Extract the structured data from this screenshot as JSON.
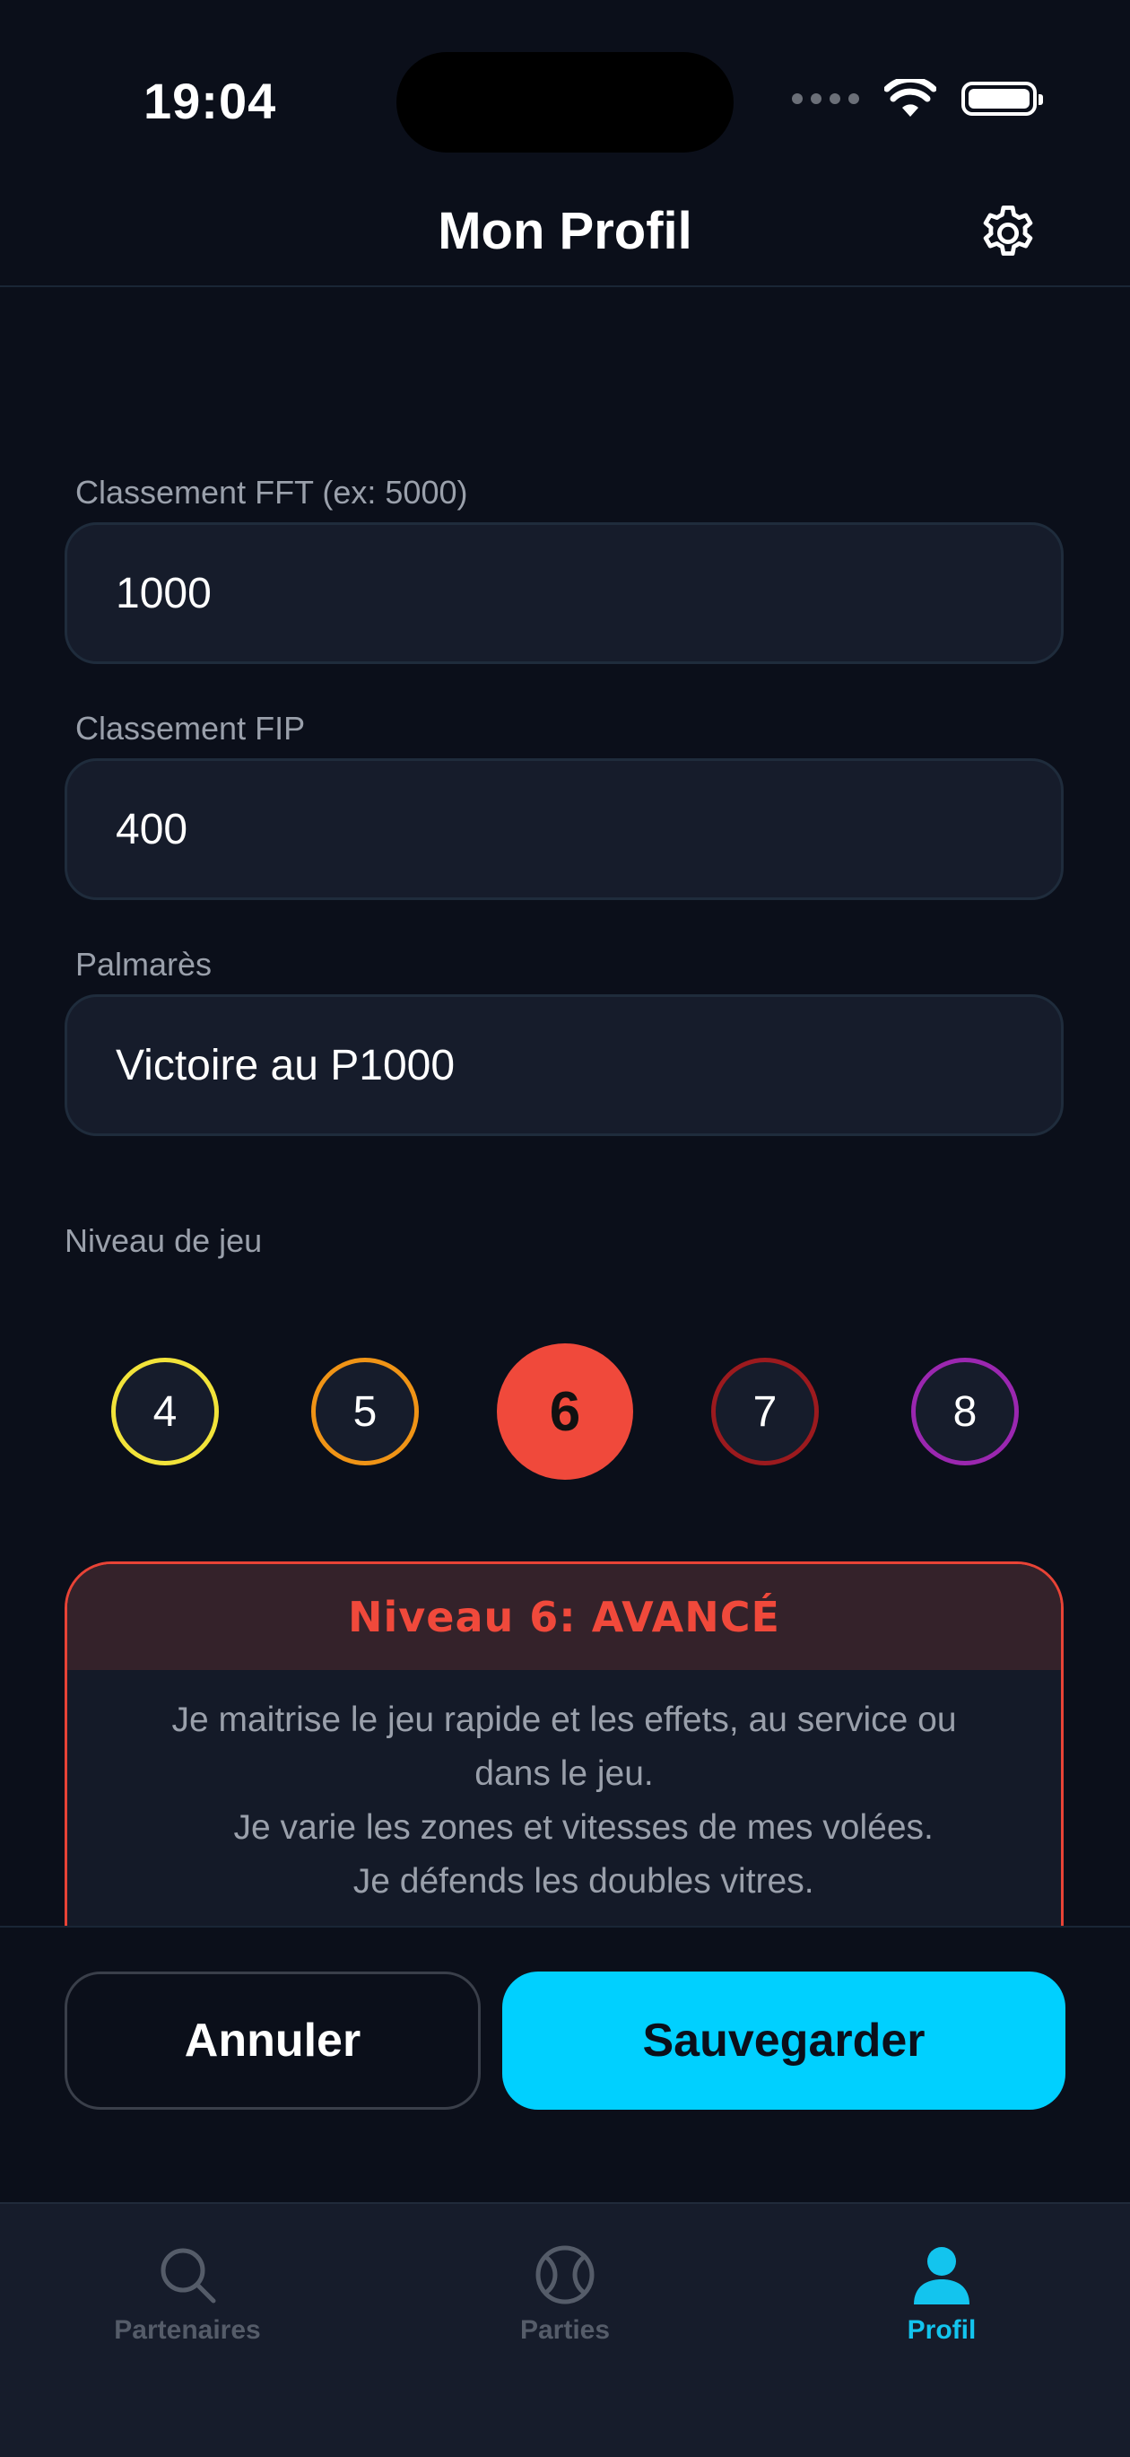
{
  "status_bar": {
    "time": "19:04"
  },
  "header": {
    "title": "Mon Profil"
  },
  "form": {
    "fft": {
      "label": "Classement FFT (ex: 5000)",
      "value": "1000"
    },
    "fip": {
      "label": "Classement FIP",
      "value": "400"
    },
    "palmares": {
      "label": "Palmarès",
      "value": "Victoire au P1000"
    }
  },
  "level": {
    "label": "Niveau de jeu",
    "options": [
      {
        "value": "4",
        "color": "#f2e33a"
      },
      {
        "value": "5",
        "color": "#f09416"
      },
      {
        "value": "6",
        "color": "#f0493b",
        "selected": true
      },
      {
        "value": "7",
        "color": "#9c1a1e"
      },
      {
        "value": "8",
        "color": "#9b27b0"
      }
    ],
    "card": {
      "title": "Niveau 6: AVANCÉ",
      "lines": [
        "Je maitrise le jeu rapide et les effets, au service ou",
        "dans le jeu.",
        "    Je varie les zones et vitesses de mes volées.",
        "    Je défends les doubles vitres."
      ]
    }
  },
  "actions": {
    "cancel": "Annuler",
    "save": "Sauvegarder"
  },
  "tabs": [
    {
      "label": "Partenaires",
      "icon": "search-icon"
    },
    {
      "label": "Parties",
      "icon": "tennis-ball-icon"
    },
    {
      "label": "Profil",
      "icon": "person-icon",
      "active": true
    }
  ],
  "colors": {
    "accent": "#00d0ff",
    "selected_level": "#f0493b",
    "background": "#0b0f1a"
  }
}
